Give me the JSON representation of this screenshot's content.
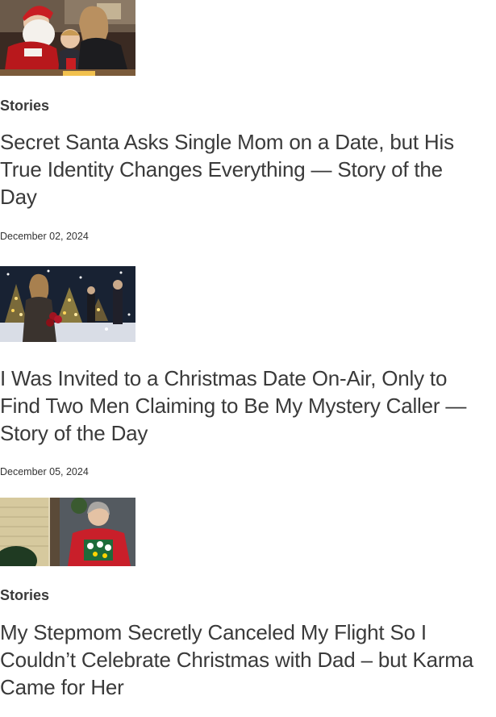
{
  "articles": [
    {
      "category": "Stories",
      "title": "Secret Santa Asks Single Mom on a Date, but His True Identity Changes Everything — Story of the Day",
      "date": "December 02, 2024",
      "image": "santa-with-mother-and-child"
    },
    {
      "category": "",
      "title": "I Was Invited to a Christmas Date On-Air, Only to Find Two Men Claiming to Be My Mystery Caller — Story of the Day",
      "date": "December 05, 2024",
      "image": "woman-with-roses-in-snowy-night"
    },
    {
      "category": "Stories",
      "title": "My Stepmom Secretly Canceled My Flight So I Couldn’t Celebrate Christmas with Dad – but Karma Came for Her",
      "date": "",
      "image": "woman-in-christmas-sweater"
    }
  ]
}
